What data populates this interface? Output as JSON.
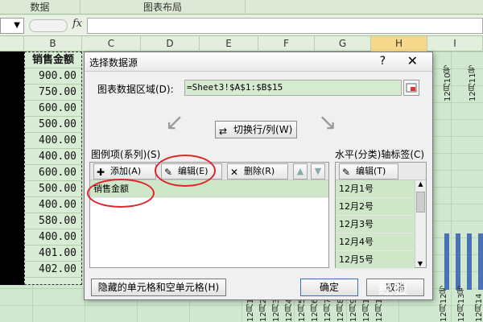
{
  "ribbon": {
    "groups": [
      "数据",
      "图表布局"
    ]
  },
  "formula_bar": {
    "fx_label": "fx"
  },
  "sheet": {
    "columns": [
      "B",
      "C",
      "D",
      "E",
      "F",
      "G",
      "H",
      "I"
    ],
    "header_cell": "销售金额",
    "values": [
      "900.00",
      "750.00",
      "600.00",
      "500.00",
      "400.00",
      "400.00",
      "600.00",
      "500.00",
      "400.00",
      "580.00",
      "400.00",
      "401.00",
      "402.00"
    ],
    "chart_axis_labels": [
      "12月1",
      "12月2",
      "12月3",
      "12月4",
      "12月5",
      "12月6",
      "12月7",
      "12月8",
      "12月9",
      "12月10",
      "12月11",
      "12月12号",
      "12月13号",
      "12月14"
    ],
    "right_labels": [
      "12月10号",
      "12月11号"
    ]
  },
  "dialog": {
    "title": "选择数据源",
    "help_icon": "?",
    "close_icon": "✕",
    "range_label": "图表数据区域(D):",
    "range_value": "=Sheet3!$A$1:$B$15",
    "switch_button": "切换行/列(W)",
    "legend_section_label": "图例项(系列)(S)",
    "add_button": "添加(A)",
    "edit_button": "编辑(E)",
    "delete_button": "删除(R)",
    "series": [
      "销售金额"
    ],
    "axis_section_label": "水平(分类)轴标签(C)",
    "axis_edit_button": "编辑(T)",
    "axis_items": [
      "12月1号",
      "12月2号",
      "12月3号",
      "12月4号",
      "12月5号"
    ],
    "hidden_cells_button": "隐藏的单元格和空单元格(H)",
    "ok_button": "确定",
    "cancel_button": "取消"
  },
  "watermark": "经验",
  "colors": {
    "highlight": "#e0242a",
    "bar": "#4a73b6",
    "sheet_bg": "#cfe8cf"
  }
}
